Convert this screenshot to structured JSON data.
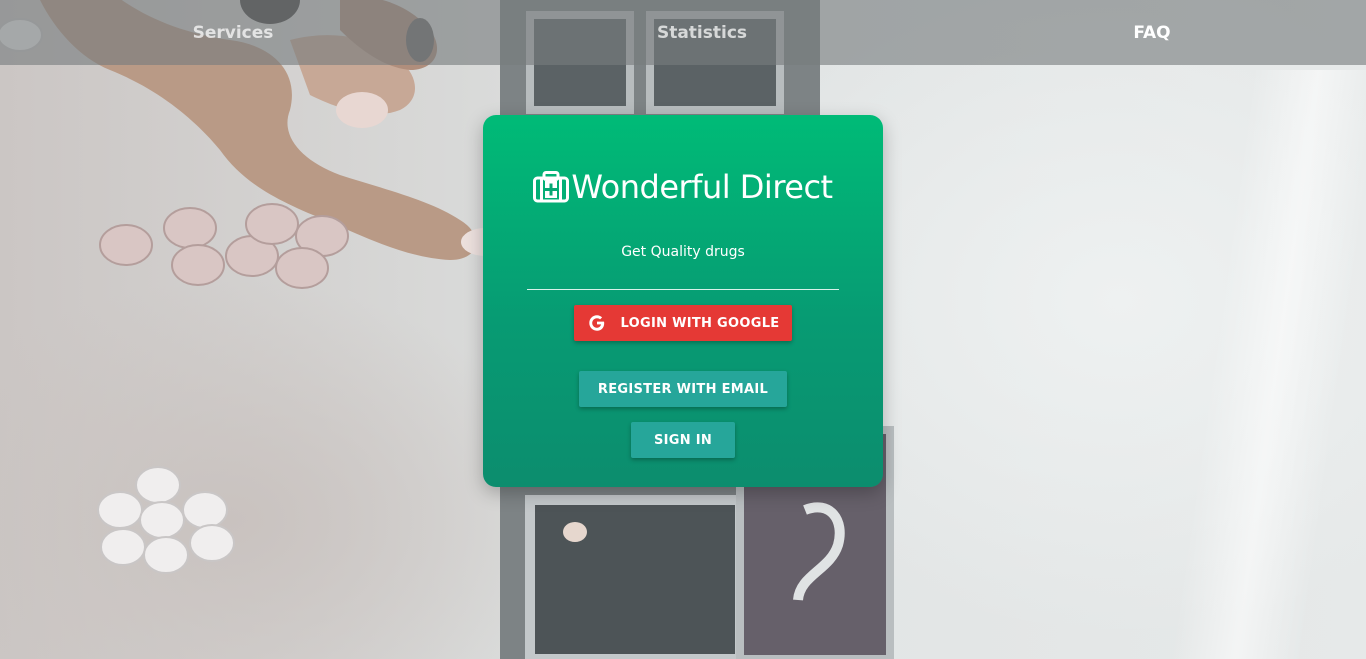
{
  "nav": {
    "items": [
      {
        "label": "Services"
      },
      {
        "label": "Statistics"
      },
      {
        "label": "FAQ"
      }
    ]
  },
  "card": {
    "brand_icon": "medical-kit-icon",
    "brand_name": "Wonderful Direct",
    "tagline": "Get Quality drugs",
    "google_button": {
      "label": "LOGIN WITH GOOGLE",
      "icon": "google-g-icon",
      "color": "#e53935"
    },
    "register_button": {
      "label": "REGISTER WITH EMAIL",
      "color": "#26a69a"
    },
    "signin_button": {
      "label": "SIGN IN",
      "color": "#26a69a"
    }
  },
  "colors": {
    "card_gradient_top": "#00bb77",
    "card_gradient_bottom": "#0c8d6e",
    "nav_overlay": "#787c7e"
  }
}
